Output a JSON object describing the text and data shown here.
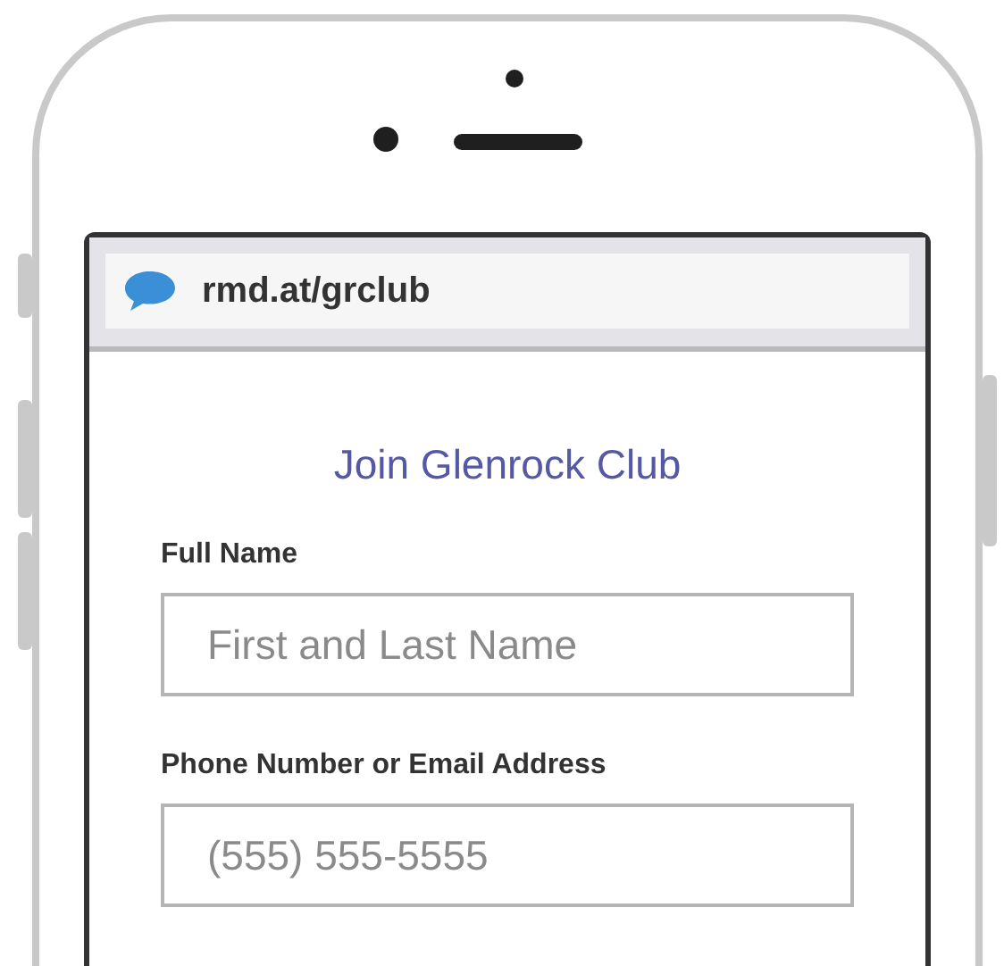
{
  "browser": {
    "url": "rmd.at/grclub"
  },
  "form": {
    "title": "Join Glenrock Club",
    "fields": [
      {
        "label": "Full Name",
        "placeholder": "First and Last Name"
      },
      {
        "label": "Phone Number or Email Address",
        "placeholder": "(555) 555-5555"
      }
    ]
  }
}
